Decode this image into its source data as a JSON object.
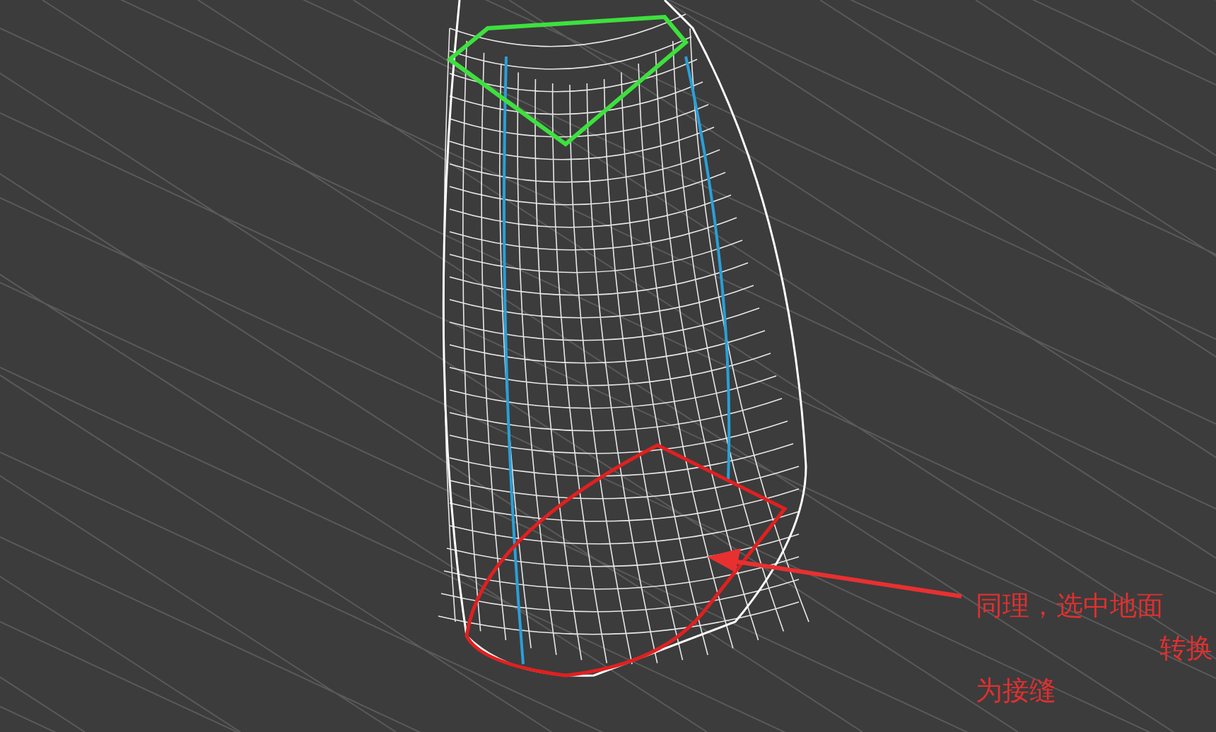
{
  "viewport": {
    "annotation": {
      "lines": [
        "同理，选中地面",
        "转换",
        "为接缝"
      ]
    }
  }
}
